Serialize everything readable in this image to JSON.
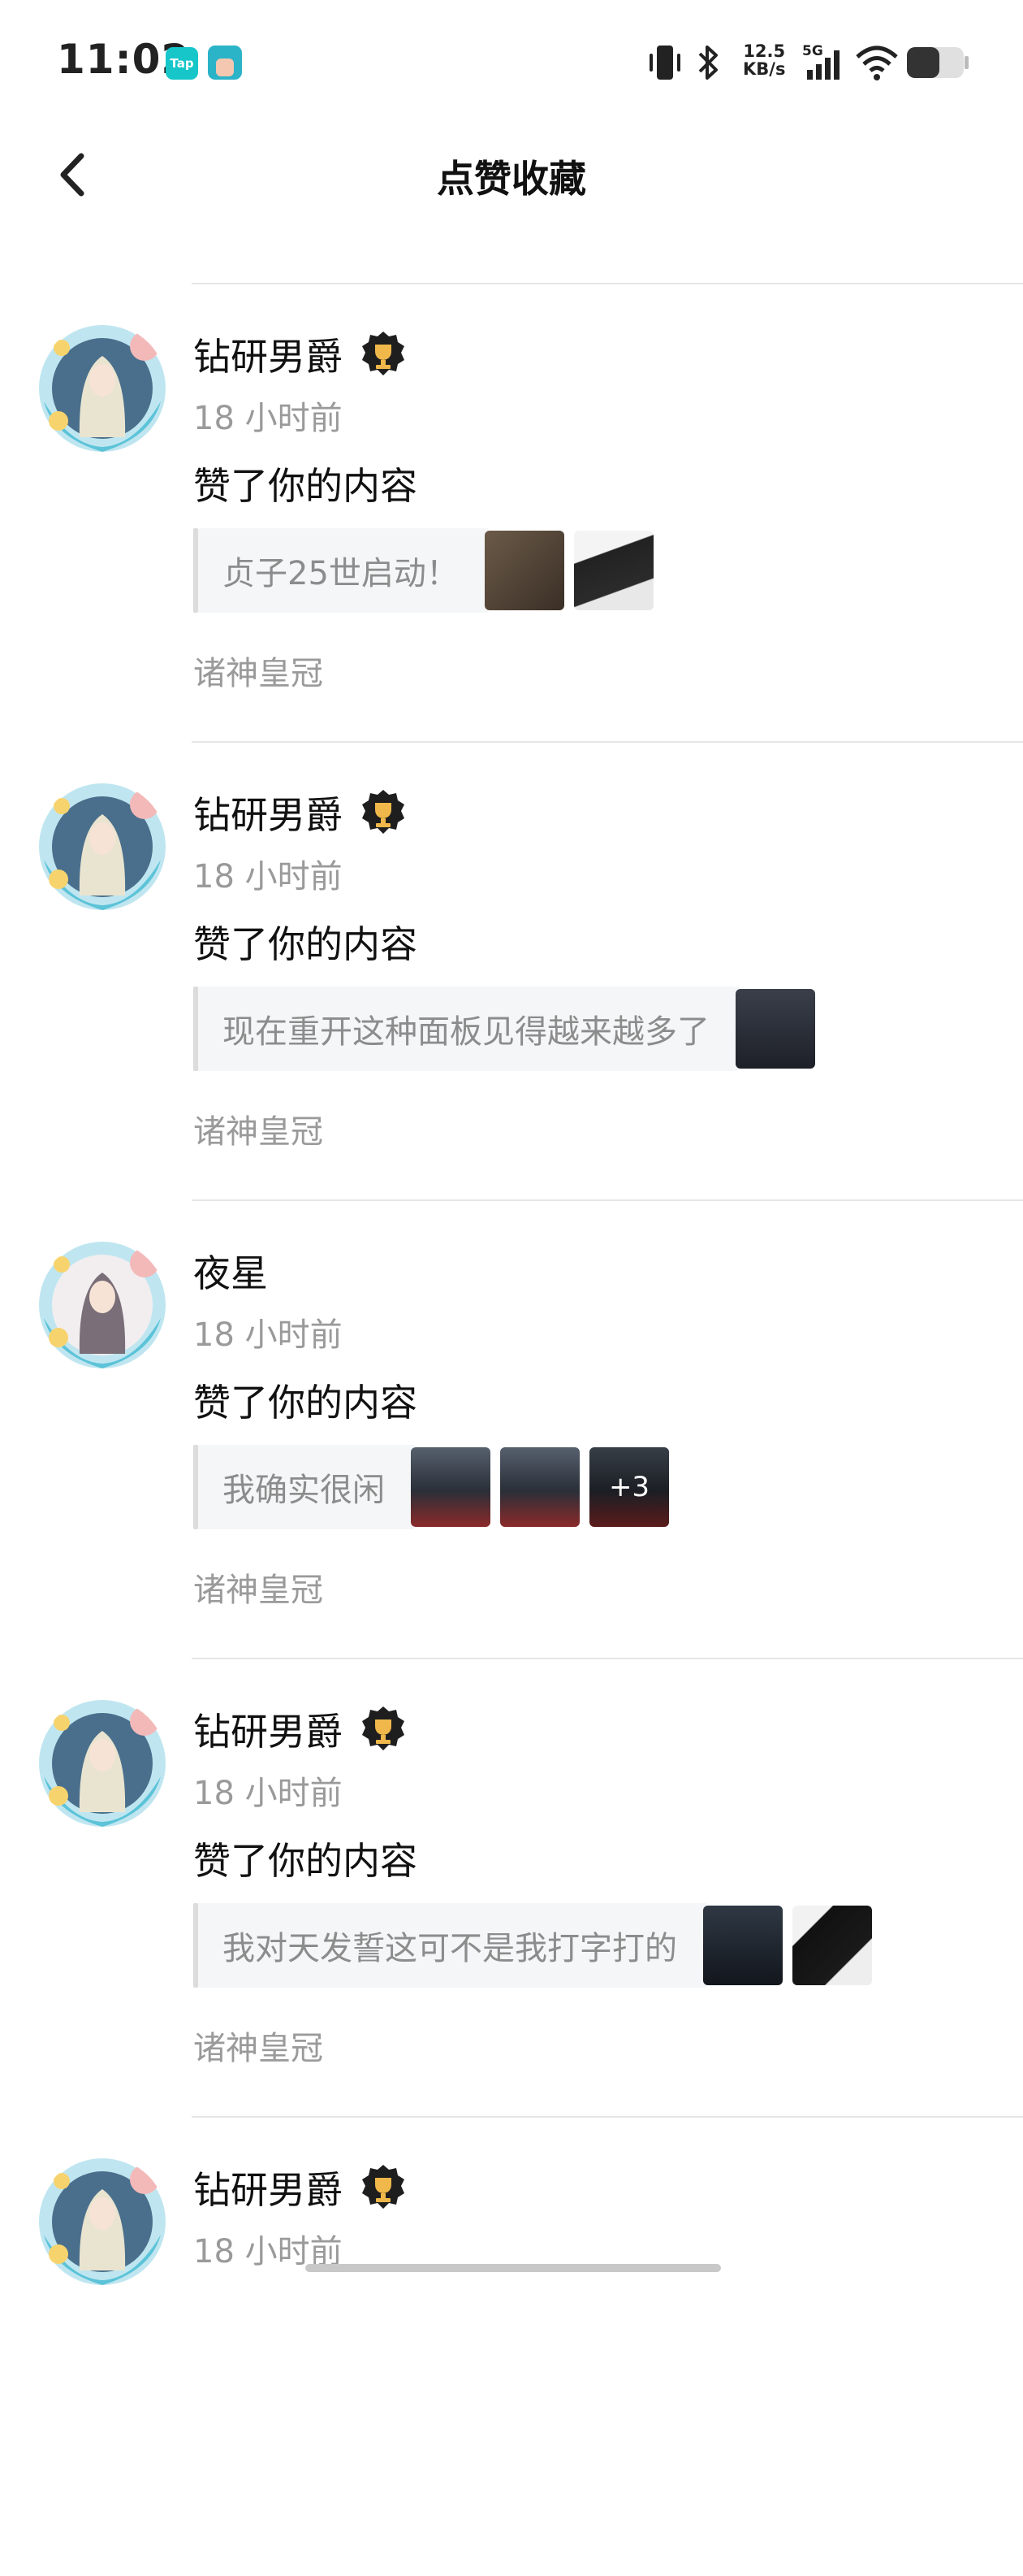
{
  "status_bar": {
    "time": "11:02",
    "app_badge_tap": "Tap",
    "net_speed_value": "12.5",
    "net_speed_unit": "KB/s",
    "network": "5G",
    "battery_level": 0.3
  },
  "header": {
    "title": "点赞收藏",
    "back_icon": "chevron-left-icon"
  },
  "items": [
    {
      "user": "钻研男爵",
      "has_badge": true,
      "time": "18 小时前",
      "action": "赞了你的内容",
      "quote": "贞子25世启动！",
      "thumbs": [
        "portrait",
        "manga"
      ],
      "more": "",
      "tag": "诸神皇冠"
    },
    {
      "user": "钻研男爵",
      "has_badge": true,
      "time": "18 小时前",
      "action": "赞了你的内容",
      "quote": "现在重开这种面板见得越来越多了",
      "thumbs": [
        "game-screen"
      ],
      "more": "",
      "tag": "诸神皇冠"
    },
    {
      "user": "夜星",
      "has_badge": false,
      "time": "18 小时前",
      "action": "赞了你的内容",
      "quote": "我确实很闲",
      "thumbs": [
        "game-panel",
        "game-panel",
        "game-panel"
      ],
      "more": "+3",
      "tag": "诸神皇冠"
    },
    {
      "user": "钻研男爵",
      "has_badge": true,
      "time": "18 小时前",
      "action": "赞了你的内容",
      "quote": "我对天发誓这可不是我打字打的",
      "thumbs": [
        "dark-ui",
        "manga-face"
      ],
      "more": "",
      "tag": "诸神皇冠"
    },
    {
      "user": "钻研男爵",
      "has_badge": true,
      "time": "18 小时前",
      "action": "",
      "quote": "",
      "thumbs": [],
      "more": "",
      "tag": ""
    }
  ],
  "colors": {
    "divider": "#e6e6e6",
    "secondary_text": "#9a9a9a",
    "quote_bg": "#f5f6f7"
  }
}
